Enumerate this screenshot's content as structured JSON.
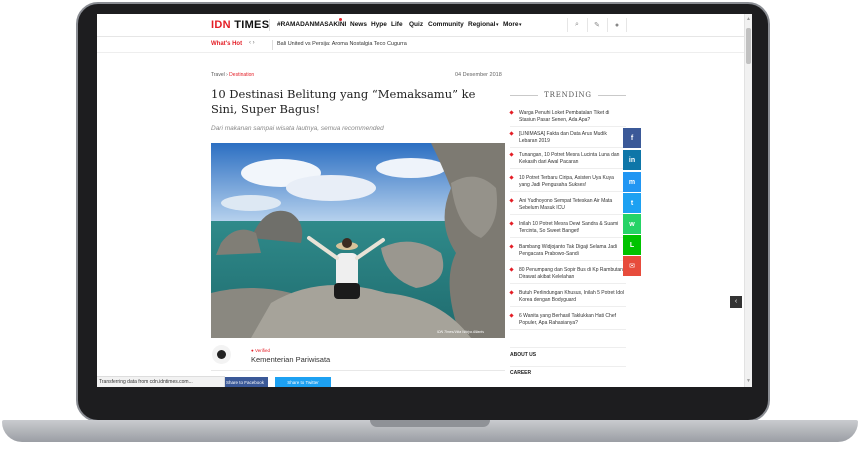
{
  "header": {
    "logo_red": "IDN",
    "logo_black": "TIMES",
    "hashtag": "#RAMADANMASAKINI",
    "nav": [
      "News",
      "Hype",
      "Life",
      "Quiz",
      "Community",
      "Regional",
      "More"
    ],
    "icons": [
      "search-icon",
      "pencil-icon",
      "user-icon"
    ]
  },
  "hotbar": {
    "label": "What's Hot",
    "arrows": "‹ ›",
    "headline": "Bali United vs Persija: Aroma Nostalgia Teco Cugurra"
  },
  "article": {
    "breadcrumb_parent": "Travel",
    "breadcrumb_sep": "›",
    "breadcrumb_current": "Destination",
    "date": "04 Desember 2018",
    "title": "10 Destinasi Belitung yang “Memaksamu”  ke Sini, Super Bagus!",
    "subtitle": "Dari makanan sampai wisata lautnya, semua recommended",
    "photo_credit": "IDN Times/Vika Widya Alliants",
    "verified_label": "Verified",
    "author": "Kementerian Pariwisata",
    "share_facebook": "Share to Facebook",
    "share_twitter": "Share to Twitter"
  },
  "status_bar": "Transferring data from cdn.idntimes.com...",
  "trending": {
    "title": "TRENDING",
    "items": [
      "Warga Penuhi Loket Pembatalan Tiket di Stasiun Pasar Senen, Ada Apa?",
      "[LINIMASA] Fakta dan Data Arus Mudik Lebaran 2019",
      "Tunangan, 10 Potret Mesra Lucinta Luna dan Kekasih dari Awal Pacaran",
      "10 Potret Terbaru Ciripa, Asisten Uya Kuya yang Jadi Pengusaha Sukses!",
      "Ani Yudhoyono Sempat Teteskan Air Mata Sebelum Masuk ICU",
      "Inilah 10 Potret Mesra Dewi Sandra & Suami Tercinta, So Sweet Banget!",
      "Bambang Widjojanto Tak Digaji Selama Jadi Pengacara Prabowo-Sandi",
      "80 Penumpang dan Sopir Bus di Kp Rambutan Dirawat akibat Kelelahan",
      "Butuh Perlindungan Khusus, Inilah 5 Potret Idol Korea dengan Bodyguard",
      "6 Wanita yang Berhasil Taklukkan Hati Chef Populer, Apa Rahasianya?"
    ]
  },
  "sidebar_links": [
    "ABOUT US",
    "CAREER"
  ],
  "share_buttons": [
    {
      "name": "facebook",
      "glyph": "f",
      "color": "#3b5998"
    },
    {
      "name": "linkedin",
      "glyph": "in",
      "color": "#0e76a8"
    },
    {
      "name": "messenger",
      "glyph": "m",
      "color": "#2196f3"
    },
    {
      "name": "twitter",
      "glyph": "t",
      "color": "#1da1f2"
    },
    {
      "name": "whatsapp",
      "glyph": "w",
      "color": "#25d366"
    },
    {
      "name": "line",
      "glyph": "L",
      "color": "#00c300"
    },
    {
      "name": "email",
      "glyph": "✉",
      "color": "#e74c3c"
    }
  ],
  "collapse_glyph": "‹",
  "colors": {
    "brand_red": "#e41e26",
    "facebook": "#3b5998",
    "twitter": "#1da1f2"
  }
}
